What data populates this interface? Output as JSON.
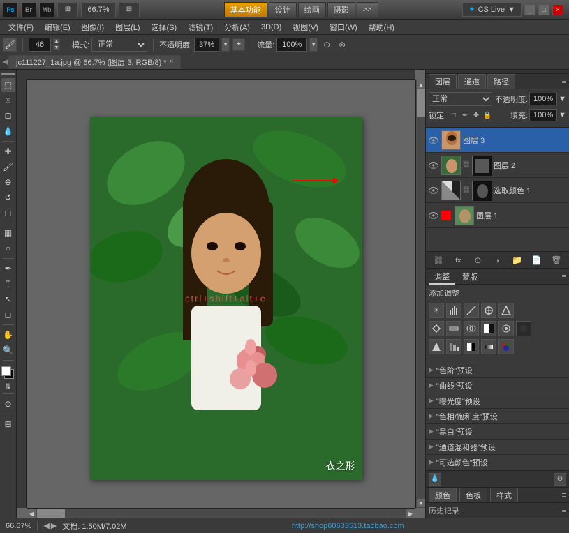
{
  "titlebar": {
    "ps_icon": "Ps",
    "br_icon": "Br",
    "mb_icon": "Mb",
    "zoom": "66.7",
    "nav_buttons": [
      "基本功能",
      "设计",
      "绘画",
      "摄影",
      ">>"
    ],
    "cs_live": "CS Live",
    "win_buttons": [
      "_",
      "□",
      "×"
    ]
  },
  "menubar": {
    "items": [
      "文件(F)",
      "编辑(E)",
      "图像(I)",
      "图层(L)",
      "选择(S)",
      "滤镜(T)",
      "分析(A)",
      "3D(D)",
      "视图(V)",
      "窗口(W)",
      "帮助(H)"
    ]
  },
  "toolbar": {
    "size": "46",
    "mode_label": "模式:",
    "mode_value": "正常",
    "opacity_label": "不透明度:",
    "opacity_value": "37%",
    "flow_label": "流量:",
    "flow_value": "100%"
  },
  "tabbar": {
    "tab_name": "jc111227_1a.jpg @ 66.7% (图层 3, RGB/8) *"
  },
  "canvas": {
    "watermark": "衣之形",
    "shortcut_text": "ctrl+shift+alt+e",
    "photo_alt": "Young woman with flowers"
  },
  "layers_panel": {
    "tab_labels": [
      "图层",
      "通道",
      "路径"
    ],
    "blend_mode": "正常",
    "opacity_label": "不透明度:",
    "opacity_value": "100%",
    "lock_label": "锁定:",
    "fill_label": "填充:",
    "fill_value": "100%",
    "layers": [
      {
        "name": "图层 3",
        "active": true,
        "has_mask": false,
        "eye": true
      },
      {
        "name": "图层 2",
        "active": false,
        "has_mask": true,
        "eye": true
      },
      {
        "name": "选取颜色 1",
        "active": false,
        "has_mask": true,
        "eye": true
      },
      {
        "name": "图层 1",
        "active": false,
        "has_mask": false,
        "eye": true
      }
    ],
    "footer_buttons": [
      "link",
      "fx",
      "mask",
      "adj",
      "group",
      "new",
      "delete"
    ]
  },
  "adjust_panel": {
    "tab_labels": [
      "调整",
      "蒙版"
    ],
    "title": "添加调整",
    "icon_rows": [
      [
        "☀",
        "📊",
        "▦",
        "⬟",
        "⬡"
      ],
      [
        "▽",
        "≡≡",
        "⚖",
        "▲",
        "🔍",
        "●"
      ],
      [
        "▣",
        "▣",
        "╱",
        "▣",
        "✕"
      ]
    ],
    "presets": [
      "\"色阶\"预设",
      "\"曲线\"预设",
      "\"曝光度\"预设",
      "\"色相/饱和度\"预设",
      "\"黑白\"预设",
      "\"通道混和器\"预设",
      "\"可选颜色\"预设"
    ]
  },
  "bottom_panel": {
    "tabs": [
      "颜色",
      "色板",
      "样式"
    ]
  },
  "history_panel": {
    "label": "历史记录"
  },
  "statusbar": {
    "zoom": "66.67%",
    "doc_info": "文档: 1.50M/7.02M",
    "url": "http://shop60633513.taobao.com"
  }
}
